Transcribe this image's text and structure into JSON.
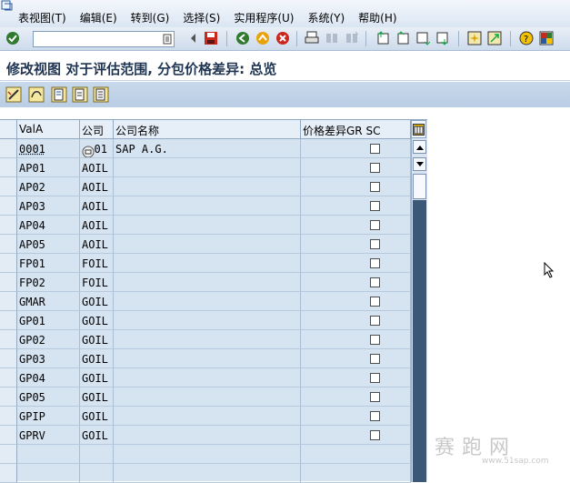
{
  "menu": {
    "items": [
      "表视图(T)",
      "编辑(E)",
      "转到(G)",
      "选择(S)",
      "实用程序(U)",
      "系统(Y)",
      "帮助(H)"
    ]
  },
  "toolbar": {
    "command_value": ""
  },
  "title": "修改视图 对于评估范围, 分包价格差异: 总览",
  "table": {
    "headers": [
      "ValA",
      "公司",
      "公司名称",
      "价格差异GR SC"
    ],
    "rows": [
      {
        "vala": "0001",
        "company": "0001",
        "name": "SAP A.G.",
        "checked": false
      },
      {
        "vala": "AP01",
        "company": "AOIL",
        "name": "",
        "checked": false
      },
      {
        "vala": "AP02",
        "company": "AOIL",
        "name": "",
        "checked": false
      },
      {
        "vala": "AP03",
        "company": "AOIL",
        "name": "",
        "checked": false
      },
      {
        "vala": "AP04",
        "company": "AOIL",
        "name": "",
        "checked": false
      },
      {
        "vala": "AP05",
        "company": "AOIL",
        "name": "",
        "checked": false
      },
      {
        "vala": "FP01",
        "company": "FOIL",
        "name": "",
        "checked": false
      },
      {
        "vala": "FP02",
        "company": "FOIL",
        "name": "",
        "checked": false
      },
      {
        "vala": "GMAR",
        "company": "GOIL",
        "name": "",
        "checked": false
      },
      {
        "vala": "GP01",
        "company": "GOIL",
        "name": "",
        "checked": false
      },
      {
        "vala": "GP02",
        "company": "GOIL",
        "name": "",
        "checked": false
      },
      {
        "vala": "GP03",
        "company": "GOIL",
        "name": "",
        "checked": false
      },
      {
        "vala": "GP04",
        "company": "GOIL",
        "name": "",
        "checked": false
      },
      {
        "vala": "GP05",
        "company": "GOIL",
        "name": "",
        "checked": false
      },
      {
        "vala": "GPIP",
        "company": "GOIL",
        "name": "",
        "checked": false
      },
      {
        "vala": "GPRV",
        "company": "GOIL",
        "name": "",
        "checked": false
      },
      {
        "vala": "",
        "company": "",
        "name": "",
        "checked": null
      },
      {
        "vala": "",
        "company": "",
        "name": "",
        "checked": null
      }
    ]
  },
  "watermark": {
    "text": "赛跑网",
    "url": "www.51sap.com"
  },
  "colors": {
    "accent": "#1f3552",
    "table_bg": "#d6e3f1",
    "scroll_track": "#3d5876"
  }
}
